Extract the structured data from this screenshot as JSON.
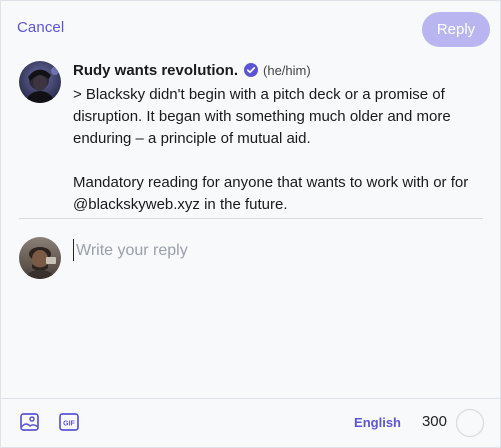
{
  "header": {
    "cancel_label": "Cancel",
    "reply_label": "Reply"
  },
  "quoted_post": {
    "author": "Rudy wants revolution.",
    "pronouns": "(he/him)",
    "paragraphs": [
      "> Blacksky didn't begin with a pitch deck or a promise of disruption. It began with something much older and more enduring – a principle of mutual aid.",
      "Mandatory reading for anyone that wants to work with or for @blackskyweb.xyz in the future."
    ],
    "verified_icon": "verified-check-icon"
  },
  "composer": {
    "placeholder": "Write your reply",
    "value": ""
  },
  "toolbar": {
    "image_icon": "image-icon",
    "gif_icon": "gif-icon",
    "gif_text": "GIF",
    "language": "English",
    "char_remaining": "300"
  },
  "colors": {
    "accent": "#5b55d6",
    "reply_button_disabled": "#b8b5f1",
    "verified": "#5b55d6"
  }
}
